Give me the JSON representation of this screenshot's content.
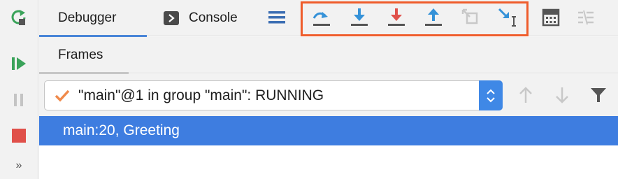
{
  "tabs": {
    "debugger": "Debugger",
    "console": "Console"
  },
  "frames": {
    "tab_label": "Frames",
    "thread_selector": "\"main\"@1 in group \"main\": RUNNING",
    "items": [
      {
        "label": "main:20, Greeting"
      }
    ]
  },
  "left_toolbar": {
    "more": "»"
  },
  "colors": {
    "accent_blue": "#3f88e6",
    "highlight_box": "#ef5c2b",
    "step_into_red": "#e0504a",
    "selection": "#3e7de0",
    "rerun_green": "#3aa35a",
    "stop_red": "#e0504a",
    "check_orange": "#f08a4b"
  },
  "icons": {
    "rerun": "rerun-icon",
    "resume": "resume-icon",
    "pause": "pause-icon",
    "stop": "stop-icon",
    "step_over": "step-over-icon",
    "step_into": "step-into-icon",
    "force_step_into": "force-step-into-icon",
    "step_out": "step-out-icon",
    "drop_frame": "drop-frame-icon",
    "run_to_cursor": "run-to-cursor-icon",
    "evaluate": "evaluate-expression-icon",
    "trace": "trace-icon"
  }
}
